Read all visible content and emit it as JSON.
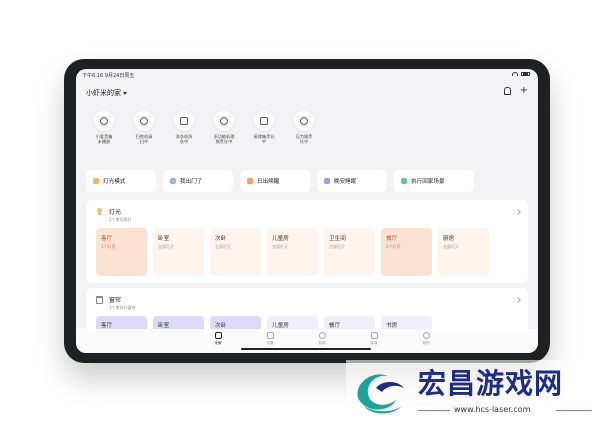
{
  "status_bar": {
    "time": "下午6:16  9月24日周五"
  },
  "header": {
    "home_title": "小虾米的家"
  },
  "devices": [
    {
      "label": "小爱音箱\n未播放",
      "icon": "speaker-icon"
    },
    {
      "label": "扫地机清\n扫中",
      "icon": "robot-vacuum-icon"
    },
    {
      "label": "洗衣机洗\n衣中",
      "icon": "washer-icon"
    },
    {
      "label": "多功能料理\n锅烹饪中",
      "icon": "cooker-icon"
    },
    {
      "label": "蒸烤箱烹饪\n中",
      "icon": "oven-icon"
    },
    {
      "label": "压力锅烹\n饪中",
      "icon": "pressure-cooker-icon"
    }
  ],
  "scenes": [
    {
      "label": "灯光模式",
      "color": "#f6b25c"
    },
    {
      "label": "我出门了",
      "color": "#8fb8f2"
    },
    {
      "label": "日出唤醒",
      "color": "#f2a25c"
    },
    {
      "label": "晚安睡眠",
      "color": "#a59be8"
    },
    {
      "label": "执行回家场景",
      "color": "#5cc2a8"
    }
  ],
  "lights": {
    "title": "灯光",
    "subtitle": "2个房间亮灯",
    "rooms": [
      {
        "name": "客厅",
        "state": "1个灯亮",
        "on": true
      },
      {
        "name": "卧室",
        "state": "全部灯灭",
        "on": false
      },
      {
        "name": "次卧",
        "state": "全部灯灭",
        "on": false
      },
      {
        "name": "儿童房",
        "state": "全部灯灭",
        "on": false
      },
      {
        "name": "卫生间",
        "state": "全部灯灭",
        "on": false
      },
      {
        "name": "餐厅",
        "state": "2个灯亮",
        "on": true
      },
      {
        "name": "厨房",
        "state": "全部灯灭",
        "on": false
      }
    ]
  },
  "curtains": {
    "title": "窗帘",
    "subtitle": "3个房间开窗帘",
    "rooms": [
      {
        "name": "客厅",
        "active": true
      },
      {
        "name": "卧室",
        "active": true
      },
      {
        "name": "次卧",
        "active": true
      },
      {
        "name": "儿童房",
        "active": false
      },
      {
        "name": "餐厅",
        "active": false
      },
      {
        "name": "书房",
        "active": false
      }
    ]
  },
  "tabbar": {
    "tabs": [
      {
        "label": "米家",
        "active": true
      },
      {
        "label": "设备",
        "active": false
      },
      {
        "label": "智能",
        "active": false
      },
      {
        "label": "商城",
        "active": false
      },
      {
        "label": "我的",
        "active": false
      }
    ]
  },
  "watermark": {
    "text": "宏昌游戏网",
    "url": "www.hcs-laser.com"
  }
}
